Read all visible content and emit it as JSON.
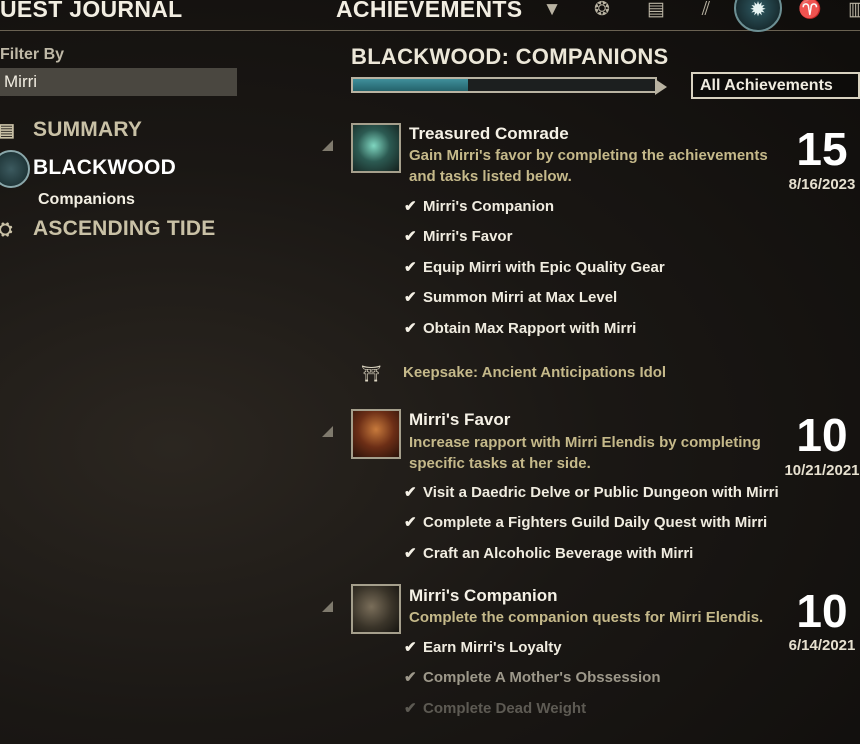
{
  "header": {
    "left_title": "UEST JOURNAL",
    "center_title": "ACHIEVEMENTS",
    "icons": [
      "tabard-icon",
      "dye-icon",
      "scroll-icon",
      "stats-icon",
      "achievements-emblem-icon",
      "trophy-icon",
      "book-icon"
    ]
  },
  "filter": {
    "label": "Filter By",
    "value": "Mirri"
  },
  "categories": {
    "summary": "SUMMARY",
    "blackwood": "BLACKWOOD",
    "blackwood_sub": "Companions",
    "ascending_tide": "ASCENDING TIDE"
  },
  "section": {
    "title": "BLACKWOOD: COMPANIONS",
    "progress_fraction": 0.38,
    "dropdown_value": "All Achievements"
  },
  "achievements": [
    {
      "name": "Treasured Comrade",
      "description": "Gain Mirri's favor by completing the achievements and tasks listed below.",
      "points": "15",
      "date": "8/16/2023",
      "tasks": [
        "Mirri's Companion",
        "Mirri's Favor",
        "Equip Mirri with Epic Quality Gear",
        "Summon Mirri at Max Level",
        "Obtain Max Rapport with Mirri"
      ],
      "reward": "Keepsake: Ancient Anticipations Idol"
    },
    {
      "name": "Mirri's Favor",
      "description": "Increase rapport with Mirri Elendis by completing specific tasks at her side.",
      "points": "10",
      "date": "10/21/2021",
      "tasks": [
        "Visit a Daedric Delve or Public Dungeon with Mirri",
        "Complete a Fighters Guild Daily Quest with Mirri",
        "Craft an Alcoholic Beverage with Mirri"
      ]
    },
    {
      "name": "Mirri's Companion",
      "description": "Complete the companion quests for Mirri Elendis.",
      "points": "10",
      "date": "6/14/2021",
      "tasks": [
        "Earn Mirri's Loyalty",
        "Complete A Mother's Obssession",
        "Complete Dead Weight"
      ]
    }
  ]
}
